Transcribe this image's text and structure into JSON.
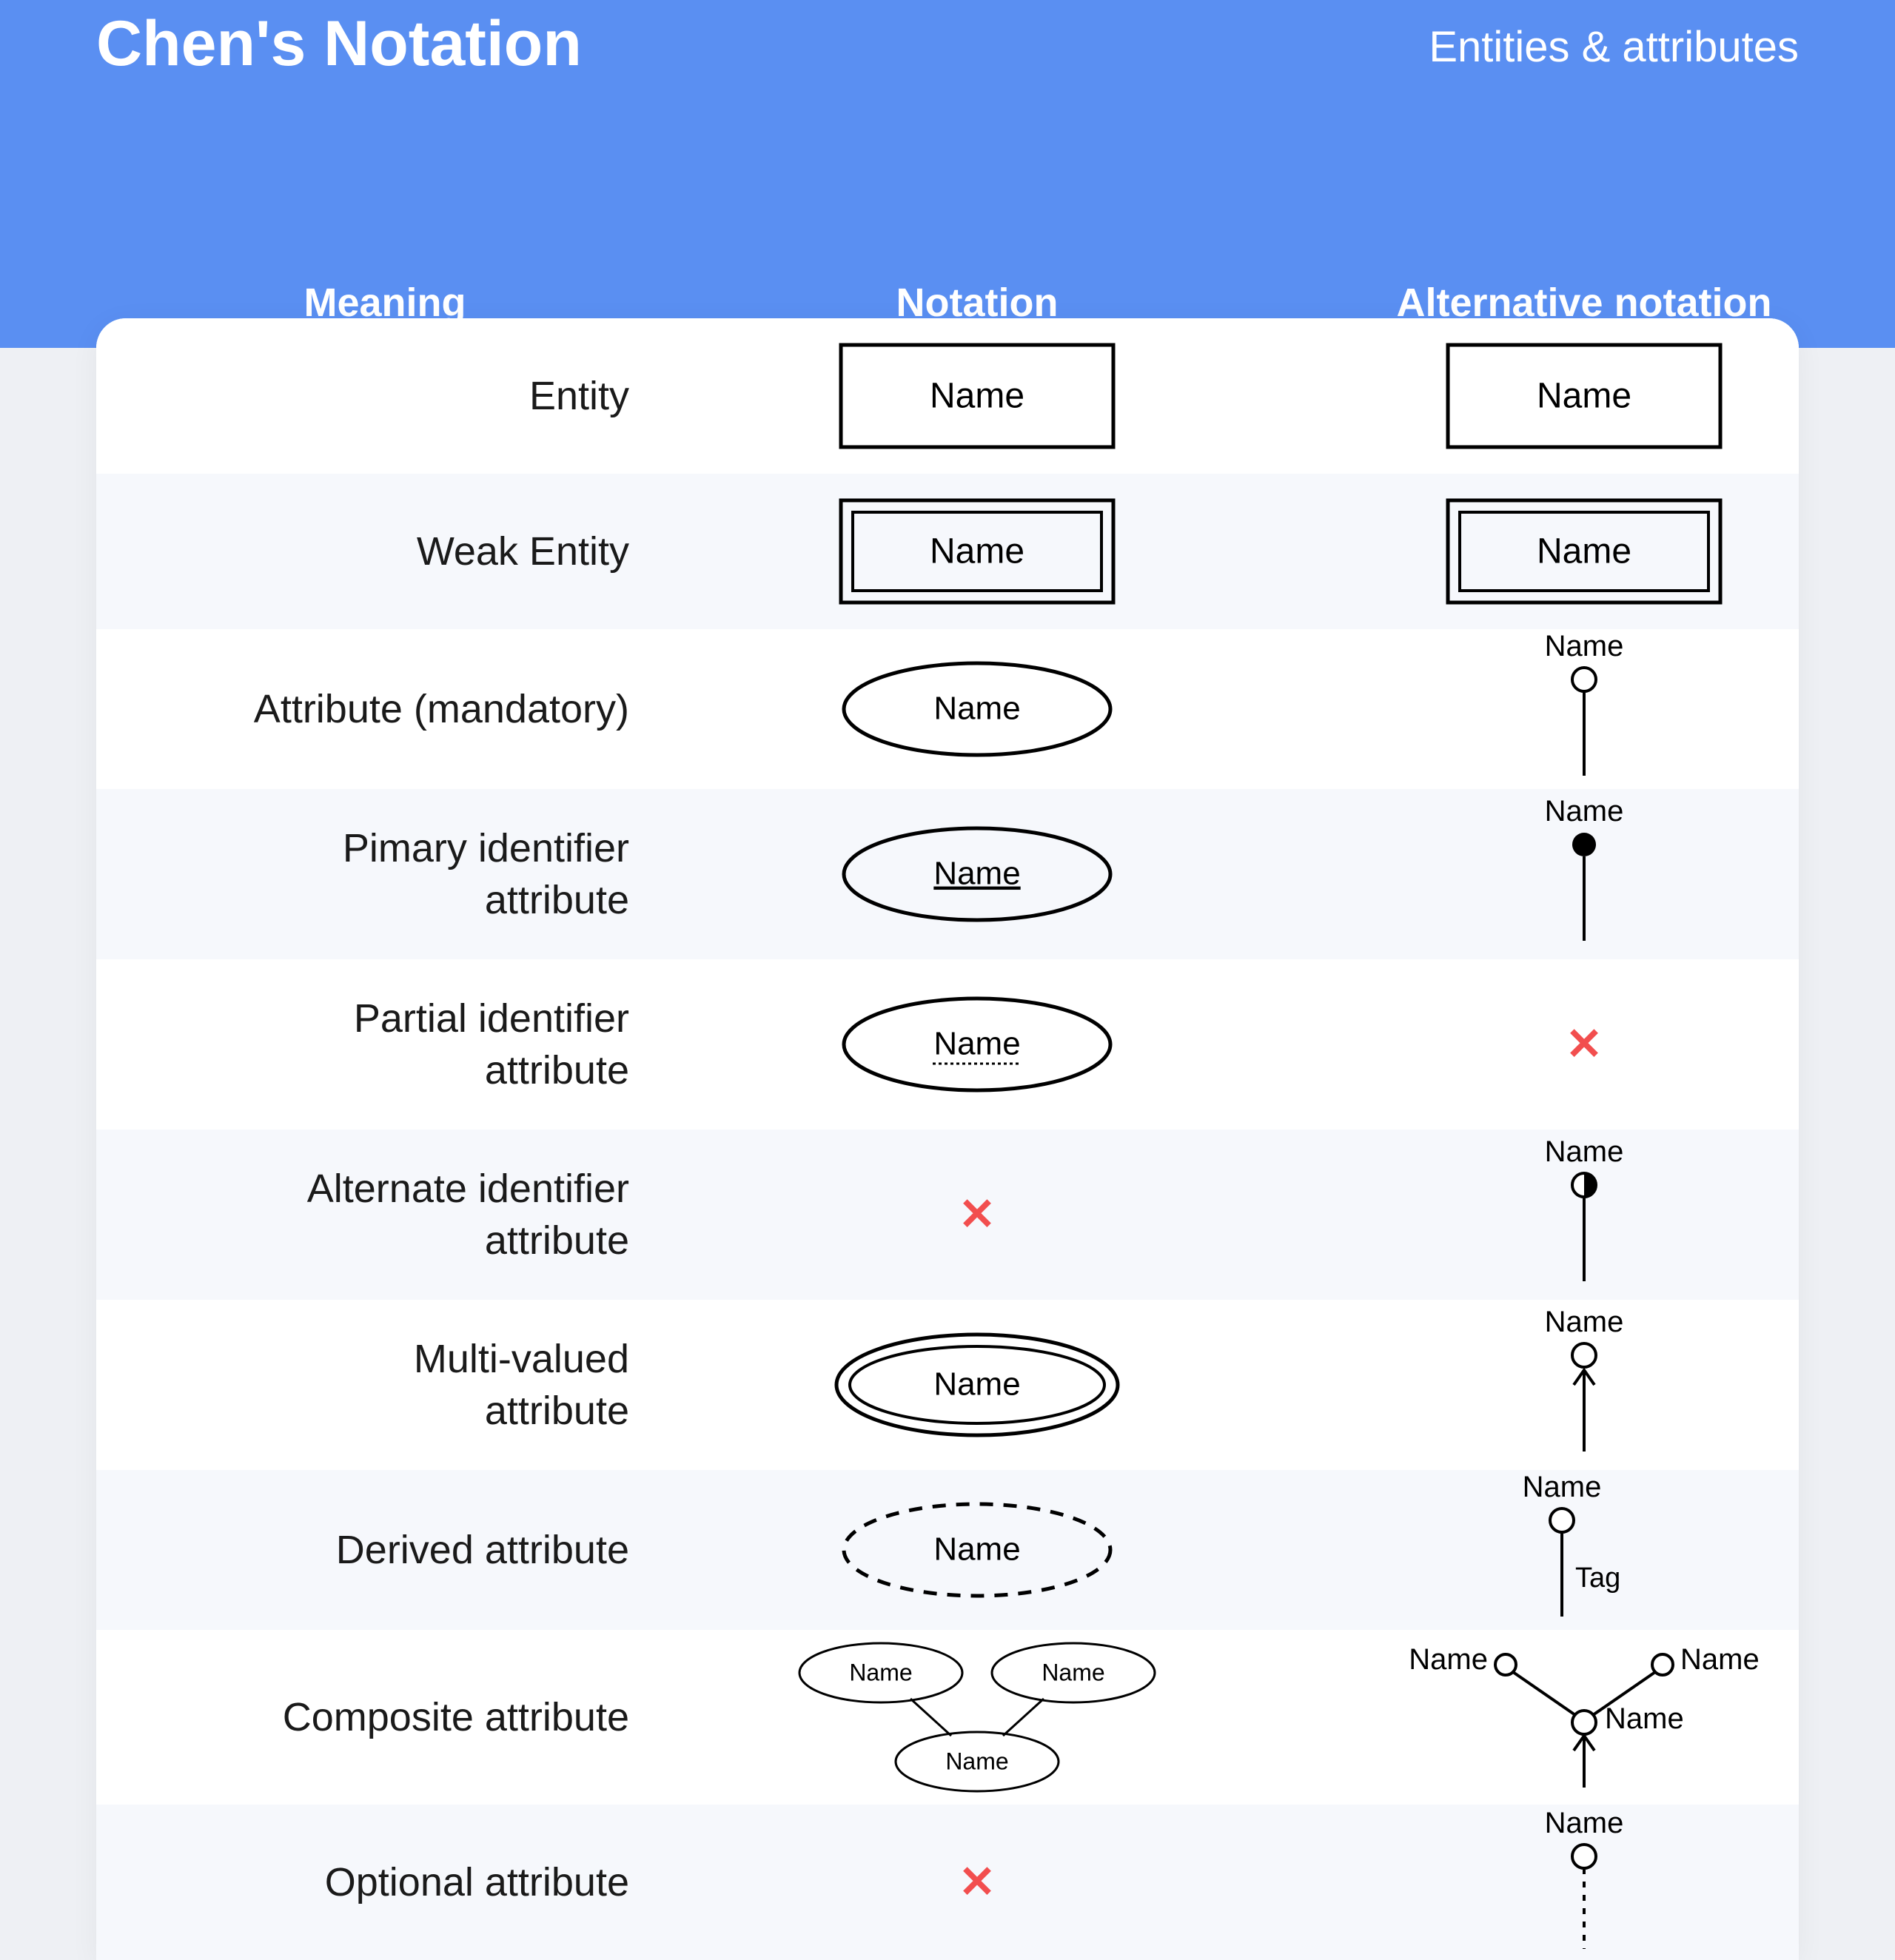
{
  "title": "Chen's Notation",
  "subtitle": "Entities & attributes",
  "columns": {
    "meaning": "Meaning",
    "notation": "Notation",
    "alt": "Alternative notation"
  },
  "label": "Name",
  "tag": "Tag",
  "rows": [
    {
      "meaning": "Entity",
      "notation": "rect",
      "alt": "rect"
    },
    {
      "meaning": "Weak Entity",
      "notation": "rect-double",
      "alt": "rect-double"
    },
    {
      "meaning": "Attribute (mandatory)",
      "notation": "ellipse",
      "alt": "pin-open"
    },
    {
      "meaning": "Pimary identifier\nattribute",
      "notation": "ellipse-under",
      "alt": "pin-filled"
    },
    {
      "meaning": "Partial identifier\nattribute",
      "notation": "ellipse-dotted-under",
      "alt": "none"
    },
    {
      "meaning": "Alternate identifier\nattribute",
      "notation": "none",
      "alt": "pin-half"
    },
    {
      "meaning": "Multi-valued\nattribute",
      "notation": "ellipse-double",
      "alt": "pin-arrow"
    },
    {
      "meaning": "Derived attribute",
      "notation": "ellipse-dashed",
      "alt": "pin-tag"
    },
    {
      "meaning": "Composite attribute",
      "notation": "composite",
      "alt": "fork"
    },
    {
      "meaning": "Optional attribute",
      "notation": "none",
      "alt": "pin-dashed"
    }
  ]
}
